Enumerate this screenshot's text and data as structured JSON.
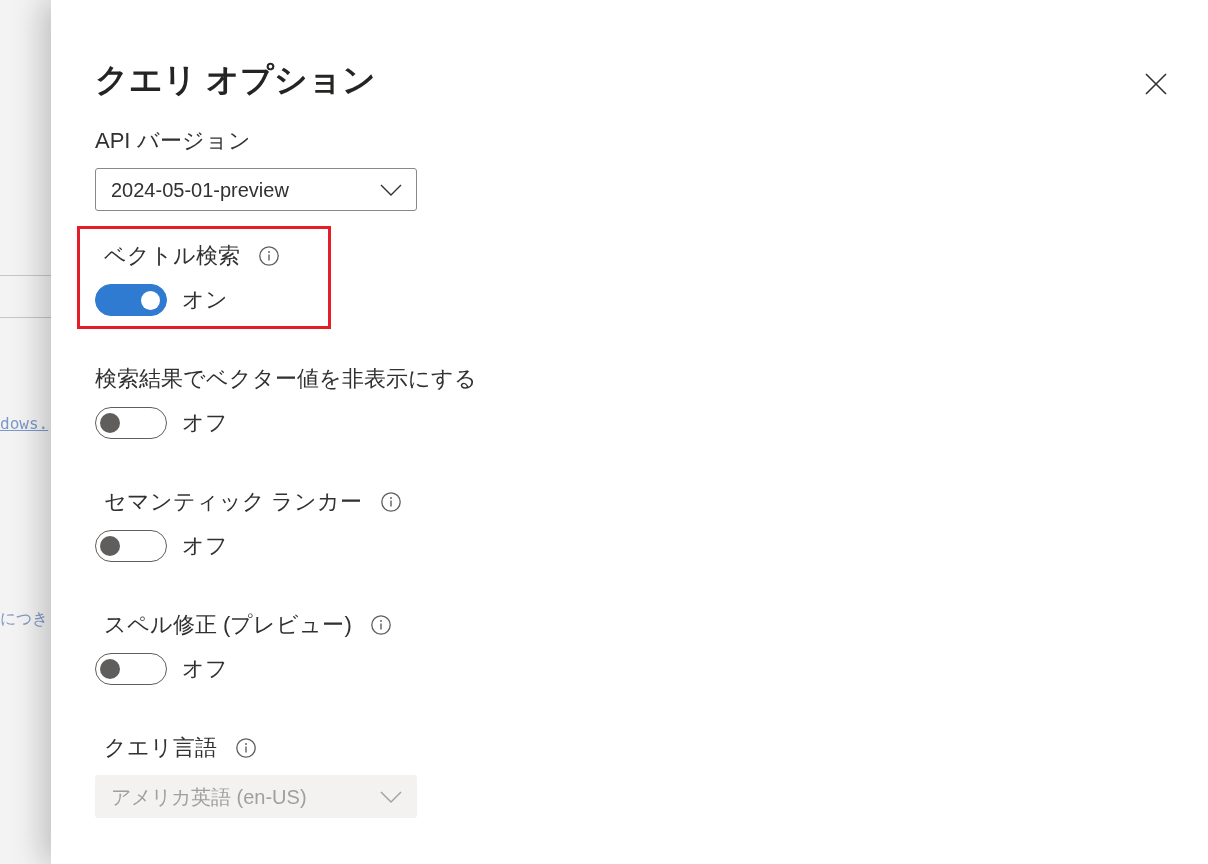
{
  "background_page": {
    "link": "dows.",
    "text": "につき"
  },
  "panel": {
    "title": "クエリ オプション",
    "fields": [
      {
        "kind": "dropdown",
        "label": "API バージョン",
        "info": false,
        "value": "2024-05-01-preview",
        "disabled": false,
        "highlighted": false
      },
      {
        "kind": "toggle",
        "label": "ベクトル検索",
        "info": true,
        "on": true,
        "state_text": "オン",
        "disabled": false,
        "highlighted": true
      },
      {
        "kind": "toggle",
        "label": "検索結果でベクター値を非表示にする",
        "info": false,
        "on": false,
        "state_text": "オフ",
        "disabled": false,
        "highlighted": false
      },
      {
        "kind": "toggle",
        "label": "セマンティック ランカー",
        "info": true,
        "on": false,
        "state_text": "オフ",
        "disabled": false,
        "highlighted": false
      },
      {
        "kind": "toggle",
        "label": "スペル修正 (プレビュー)",
        "info": true,
        "on": false,
        "state_text": "オフ",
        "disabled": false,
        "highlighted": false
      },
      {
        "kind": "dropdown",
        "label": "クエリ言語",
        "info": true,
        "value": "アメリカ英語 (en-US)",
        "disabled": true,
        "highlighted": false
      }
    ]
  }
}
